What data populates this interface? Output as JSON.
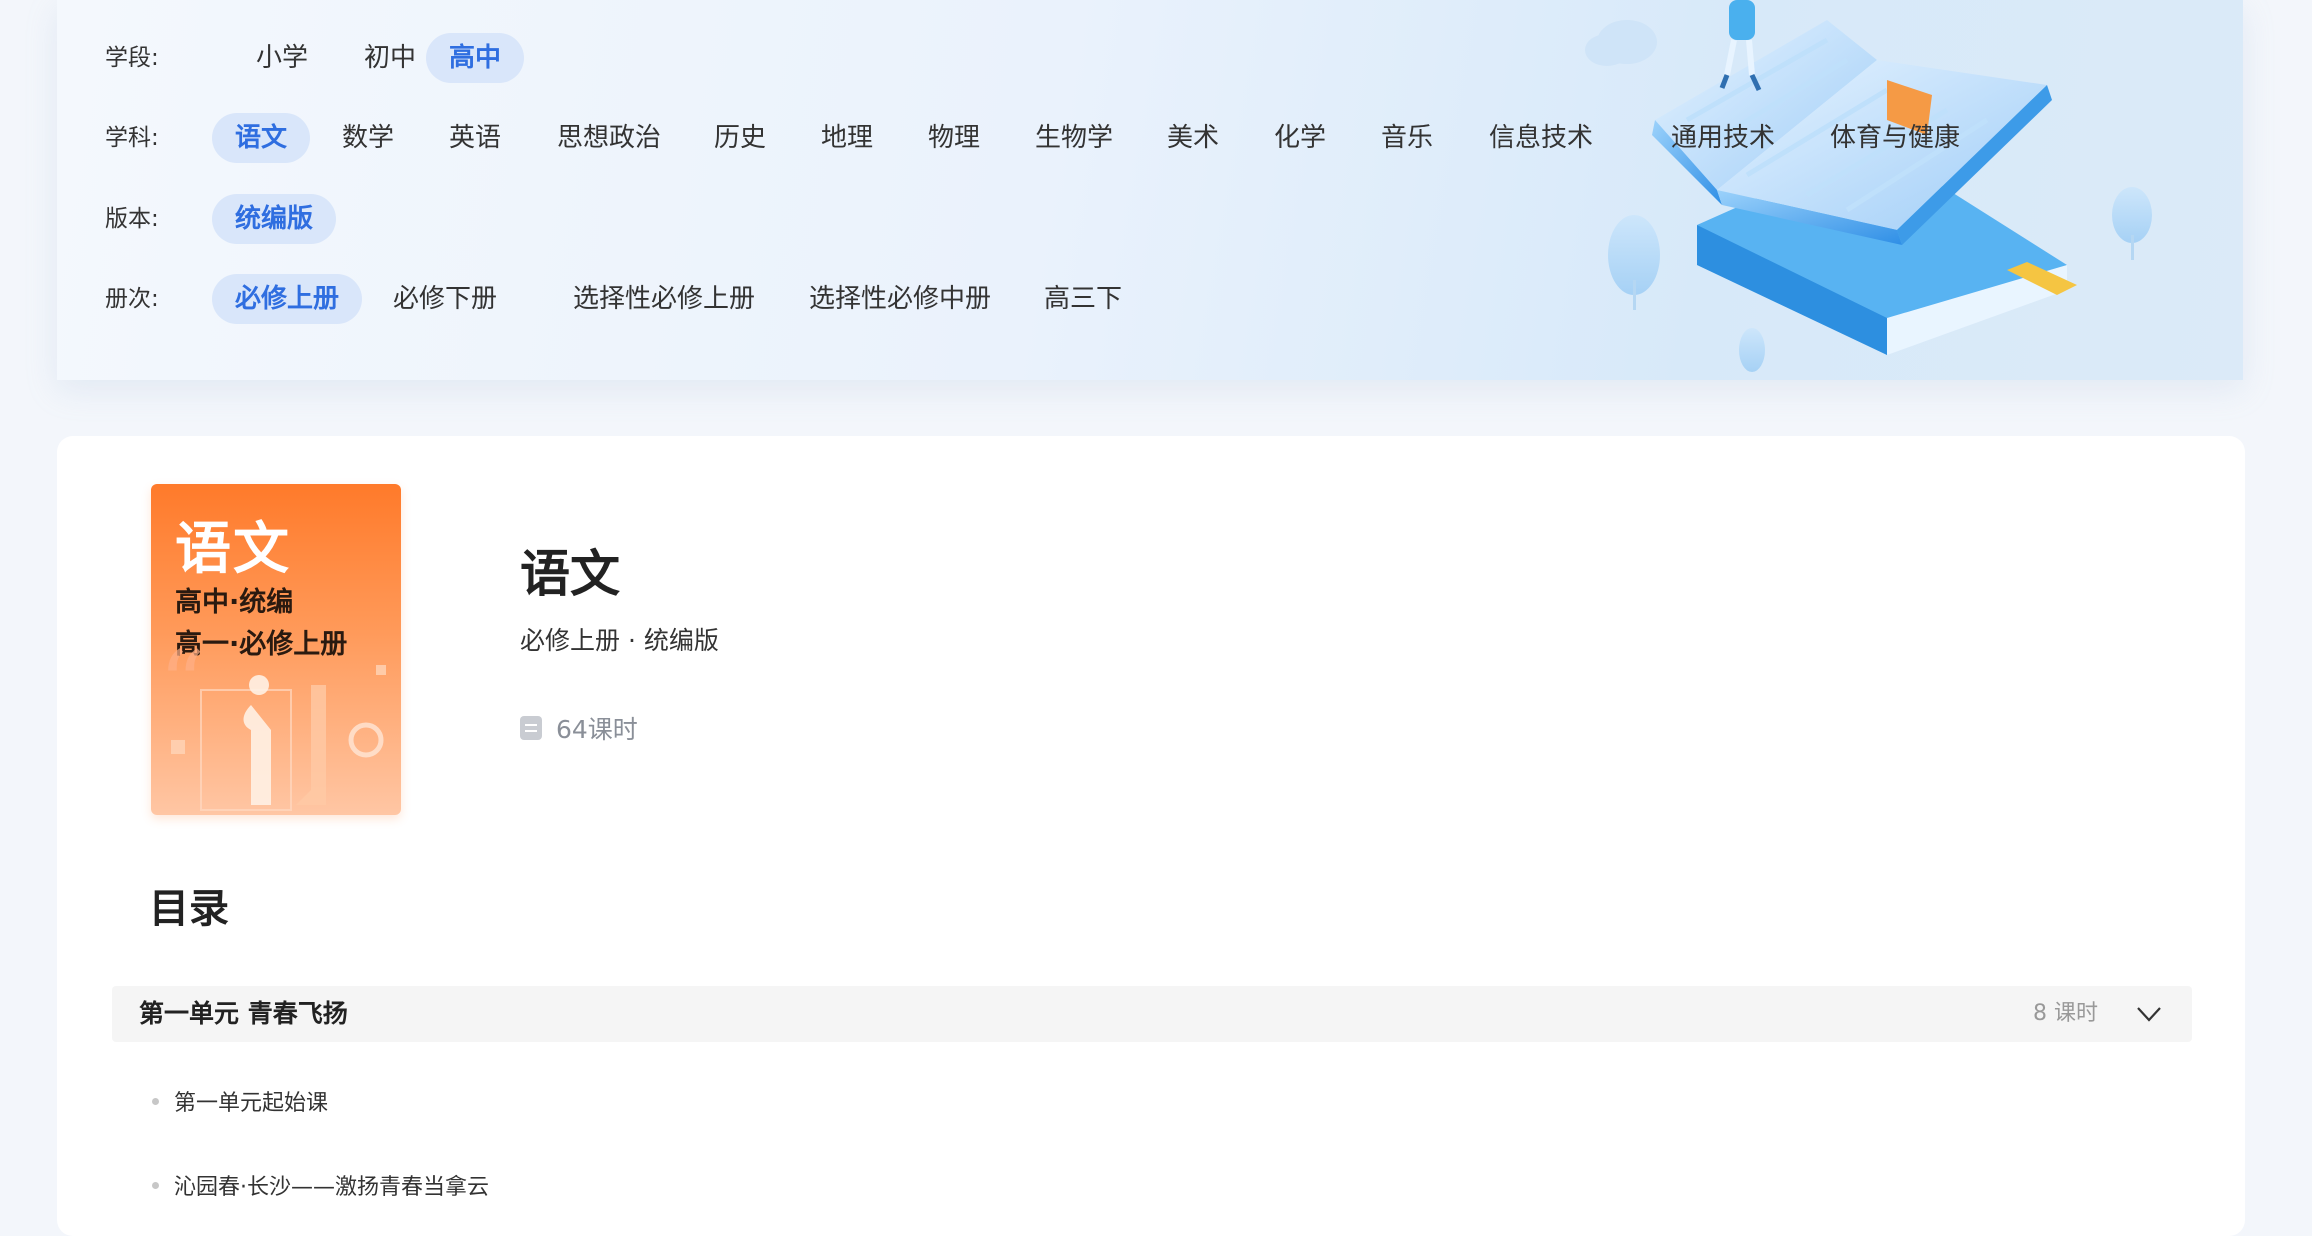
{
  "filters": {
    "stage": {
      "label": "学段:",
      "options": [
        "小学",
        "初中",
        "高中"
      ],
      "selected": "高中"
    },
    "subject": {
      "label": "学科:",
      "options": [
        "语文",
        "数学",
        "英语",
        "思想政治",
        "历史",
        "地理",
        "物理",
        "生物学",
        "美术",
        "化学",
        "音乐",
        "信息技术",
        "通用技术",
        "体育与健康"
      ],
      "selected": "语文"
    },
    "edition": {
      "label": "版本:",
      "options": [
        "统编版"
      ],
      "selected": "统编版"
    },
    "volume": {
      "label": "册次:",
      "options": [
        "必修上册",
        "必修下册",
        "选择性必修上册",
        "选择性必修中册",
        "高三下"
      ],
      "selected": "必修上册"
    }
  },
  "book": {
    "cover": {
      "title": "语文",
      "line1": "高中·统编",
      "line2": "高一·必修上册"
    },
    "title": "语文",
    "subtitle": "必修上册 · 统编版",
    "lesson_count": "64课时"
  },
  "toc": {
    "heading": "目录",
    "units": [
      {
        "title": "第一单元 青春飞扬",
        "lessons_label": "8 课时",
        "lessons": [
          "第一单元起始课",
          "沁园春·长沙——激扬青春当拿云"
        ]
      }
    ]
  },
  "colors": {
    "accent": "#2f6ee0",
    "chip_active_bg": "#d9e6fa",
    "cover_orange": "#ff7a2a"
  }
}
